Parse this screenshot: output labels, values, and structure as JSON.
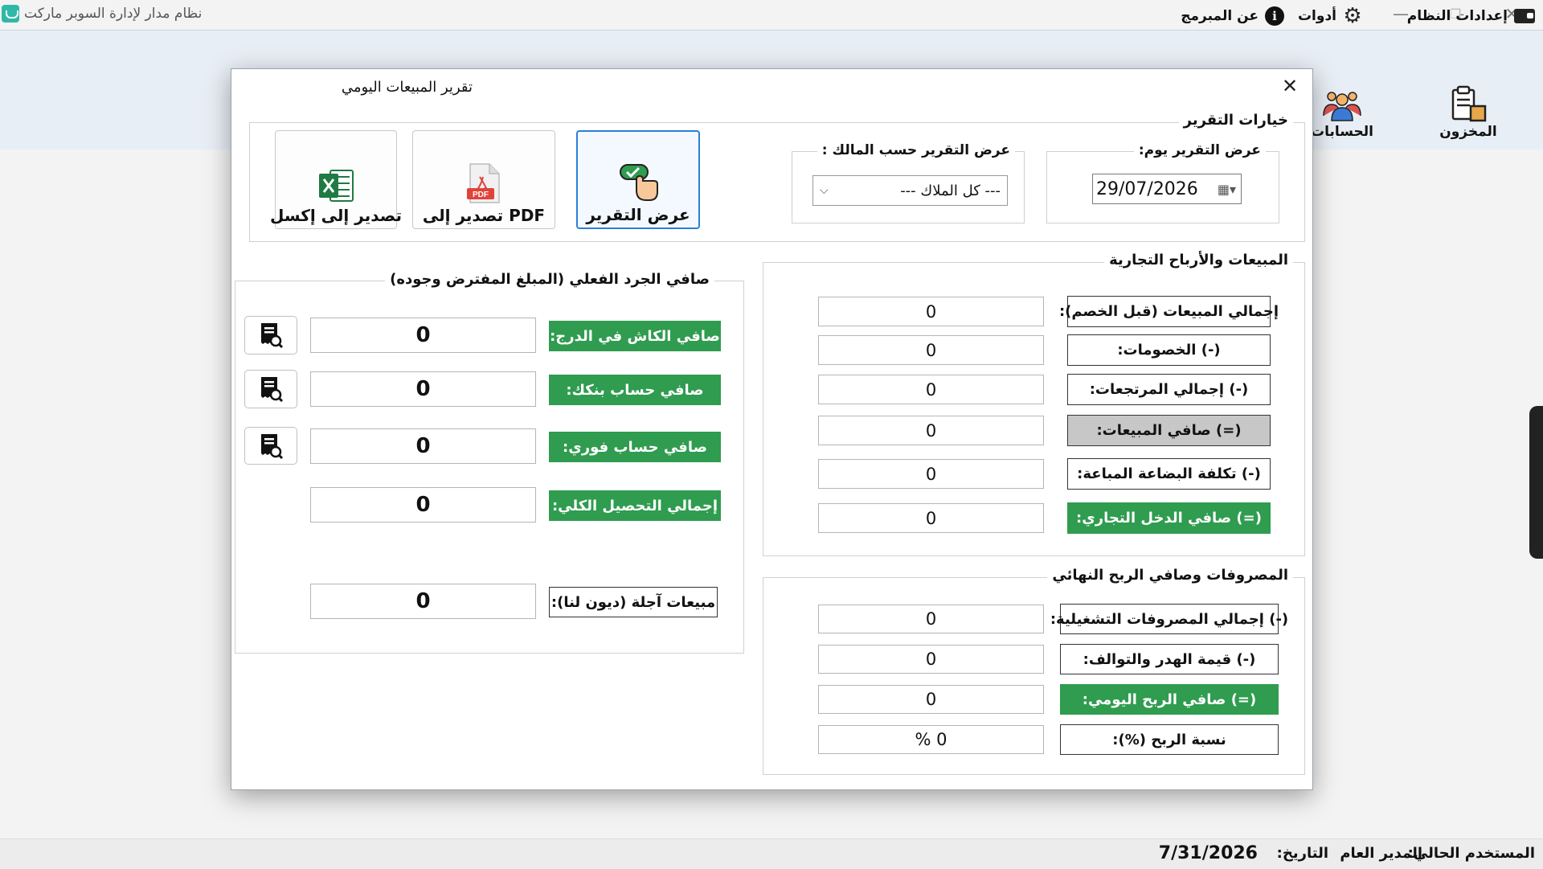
{
  "window": {
    "title": "نظام مدار لإدارة السوبر ماركت",
    "minimize": "—",
    "maximize": "❐",
    "close": "✕"
  },
  "menu": {
    "system_settings": "إعدادات النظام",
    "tools": "أدوات",
    "about": "عن المبرمج"
  },
  "toolbar": {
    "inventory": "المخزون",
    "accounts": "الحسابات"
  },
  "status": {
    "current_user_label": "المستخدم الحالي:",
    "current_user": "المدير العام",
    "date_label": "التاريخ:",
    "date": "7/31/2026"
  },
  "dialog": {
    "title": "تقرير المبيعات اليومي",
    "options": {
      "title": "خيارات التقرير",
      "date_group_title": "عرض التقرير يوم:",
      "date_value": "29/07/2026",
      "owner_group_title": "عرض التقرير حسب المالك :",
      "owner_value": "--- كل الملاك ---",
      "show_report": "عرض التقرير",
      "export_pdf": "تصدير إلى PDF",
      "export_excel": "تصدير إلى إكسل",
      "pdf_badge": "PDF"
    },
    "sales": {
      "title": "المبيعات والأرباح التجارية",
      "rows": [
        {
          "label": "إجمالي المبيعات (قبل الخصم):",
          "value": "0"
        },
        {
          "label": "(-) الخصومات:",
          "value": "0"
        },
        {
          "label": "(-) إجمالي المرتجعات:",
          "value": "0"
        },
        {
          "label": "(=) صافي المبيعات:",
          "value": "0"
        },
        {
          "label": "(-) تكلفة البضاعة المباعة:",
          "value": "0"
        },
        {
          "label": "(=) صافي الدخل التجاري:",
          "value": "0"
        }
      ]
    },
    "expenses": {
      "title": "المصروفات وصافي الربح النهائي",
      "rows": [
        {
          "label": "(-) إجمالي المصروفات التشغيلية:",
          "value": "0"
        },
        {
          "label": "(-) قيمة الهدر والتوالف:",
          "value": "0"
        },
        {
          "label": "(=) صافي الربح اليومي:",
          "value": "0"
        },
        {
          "label": "نسبة الربح (%):",
          "value": "% 0"
        }
      ]
    },
    "cash": {
      "title": "صافي الجرد الفعلي (المبلغ المفترض وجوده)",
      "rows": [
        {
          "label": "صافي الكاش في الدرج:",
          "value": "0"
        },
        {
          "label": "صافي حساب بنكك:",
          "value": "0"
        },
        {
          "label": "صافي حساب فوري:",
          "value": "0"
        },
        {
          "label": "إجمالي التحصيل الكلي:",
          "value": "0"
        },
        {
          "label": "مبيعات آجلة (ديون لنا):",
          "value": "0"
        }
      ]
    }
  },
  "colors": {
    "accent_green": "#2f9c4f",
    "highlight_gray": "#c7c7c7",
    "active_border": "#2b7fd8"
  },
  "icons": [
    "wallet-icon",
    "gear-icon",
    "info-icon",
    "inventory-icon",
    "accounts-icon",
    "show-report-icon",
    "pdf-icon",
    "excel-icon",
    "calendar-icon",
    "chevron-down-icon",
    "receipt-search-icon"
  ]
}
